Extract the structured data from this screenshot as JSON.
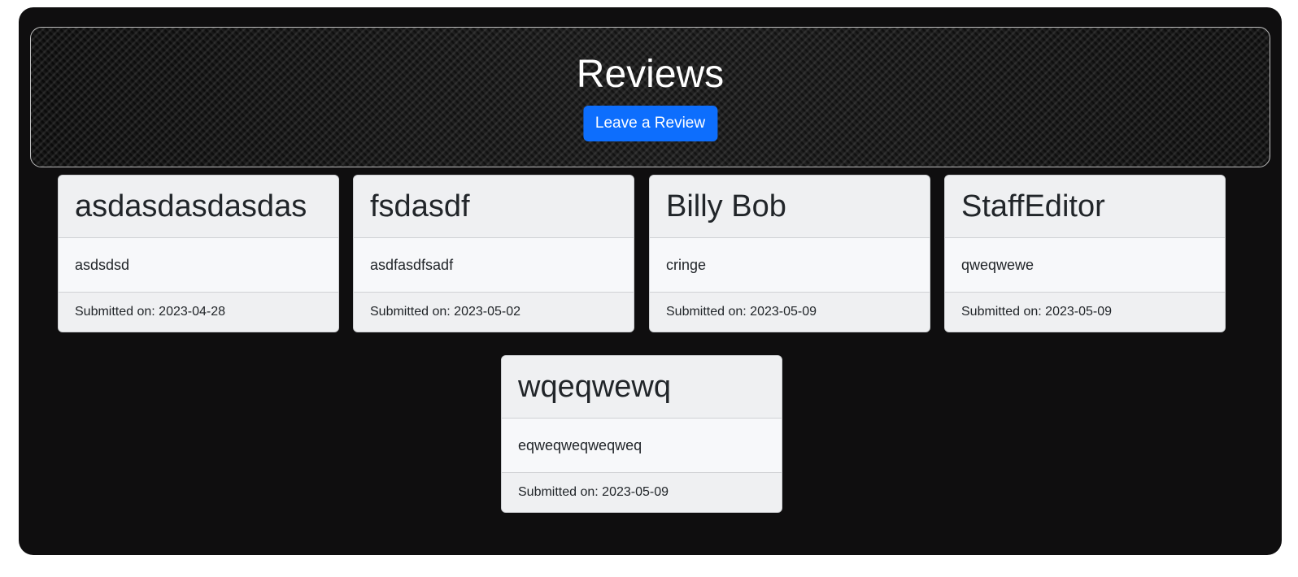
{
  "hero": {
    "title": "Reviews",
    "button_label": "Leave a Review"
  },
  "footer_prefix": "Submitted on: ",
  "reviews": [
    {
      "title": "asdasdasdasdas",
      "text": "asdsdsd",
      "date": "2023-04-28"
    },
    {
      "title": "fsdasdf",
      "text": "asdfasdfsadf",
      "date": "2023-05-02"
    },
    {
      "title": "Billy Bob",
      "text": "cringe",
      "date": "2023-05-09"
    },
    {
      "title": "StaffEditor",
      "text": "qweqwewe",
      "date": "2023-05-09"
    },
    {
      "title": "wqeqwewq",
      "text": "eqweqweqweqweq",
      "date": "2023-05-09"
    }
  ],
  "colors": {
    "panel_bg": "#0f0e0f",
    "button_bg": "#0d6efd",
    "card_header_bg": "#eff0f2",
    "card_body_bg": "#f7f8fa"
  }
}
